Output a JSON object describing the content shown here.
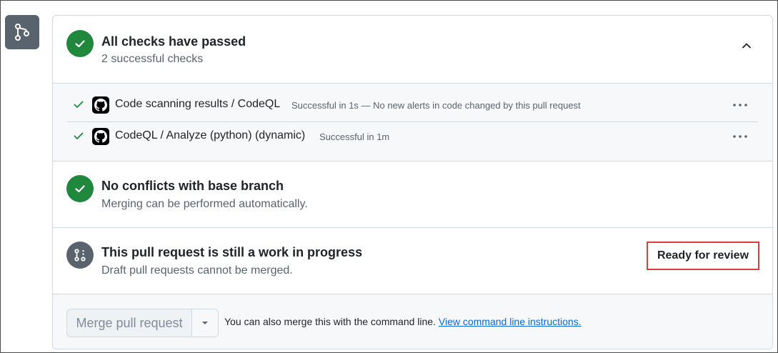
{
  "checks_summary": {
    "title": "All checks have passed",
    "subtitle": "2 successful checks"
  },
  "checks": [
    {
      "name": "Code scanning results / CodeQL",
      "description": "Successful in 1s — No new alerts in code changed by this pull request"
    },
    {
      "name": "CodeQL / Analyze (python) (dynamic)",
      "description": "Successful in 1m"
    }
  ],
  "conflicts": {
    "title": "No conflicts with base branch",
    "subtitle": "Merging can be performed automatically."
  },
  "draft": {
    "title": "This pull request is still a work in progress",
    "subtitle": "Draft pull requests cannot be merged.",
    "ready_button": "Ready for review"
  },
  "merge": {
    "button_label": "Merge pull request",
    "hint_text": "You can also merge this with the command line.",
    "link_text": "View command line instructions."
  },
  "colors": {
    "success": "#1f883d",
    "neutral": "#59636e",
    "link": "#0969da",
    "highlight_border": "#e03c3c"
  },
  "icons": {
    "timeline": "git-branch-icon",
    "success": "check-circle-icon",
    "draft": "git-pull-request-draft-icon",
    "collapse": "chevron-up-icon",
    "app": "github-logo-icon",
    "menu": "kebab-horizontal-icon",
    "dropdown": "triangle-down-icon"
  }
}
